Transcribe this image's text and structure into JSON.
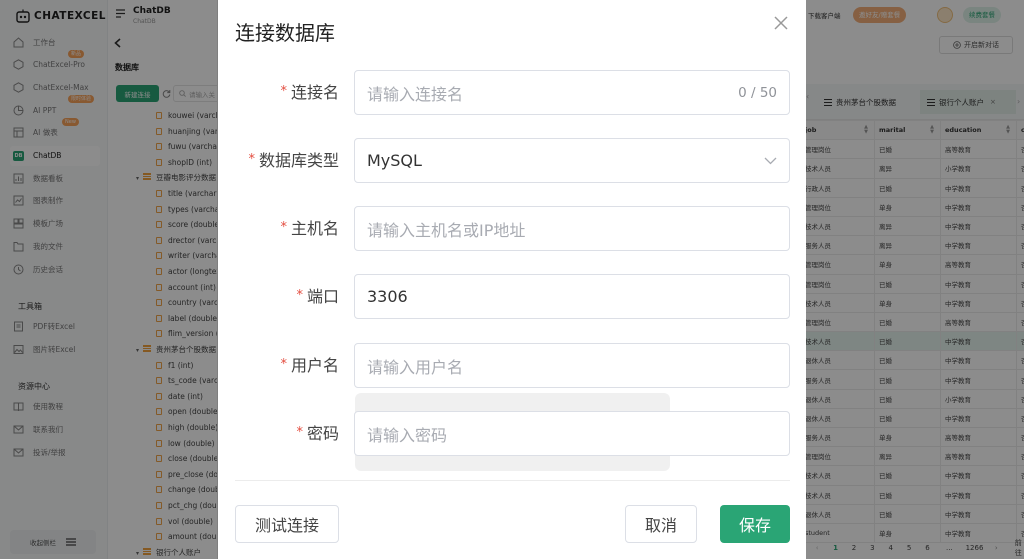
{
  "app": {
    "logo_text": "ChatExcel",
    "colors": {
      "accent": "#2aa575",
      "badge": "#f7a25a",
      "required": "#e34b3e"
    }
  },
  "sidebar": {
    "items": [
      {
        "label": "工作台",
        "icon": "home-icon"
      },
      {
        "label": "ChatExcel-Pro",
        "icon": "hexagon-icon",
        "badge": "新品"
      },
      {
        "label": "ChatExcel-Max",
        "icon": "hexagon-icon"
      },
      {
        "label": "AI PPT",
        "icon": "ppt-icon",
        "badge": "限时体验"
      },
      {
        "label": "AI 做表",
        "icon": "table-icon",
        "badge": "New"
      },
      {
        "label": "ChatDB",
        "icon": "db-icon",
        "active": true
      },
      {
        "label": "数据看板",
        "icon": "dashboard-icon"
      },
      {
        "label": "图表制作",
        "icon": "chart-icon"
      },
      {
        "label": "模板广场",
        "icon": "template-icon"
      },
      {
        "label": "我的文件",
        "icon": "file-icon"
      },
      {
        "label": "历史会话",
        "icon": "history-icon"
      }
    ],
    "tools_title": "工具箱",
    "tools": [
      {
        "label": "PDF转Excel",
        "icon": "pdf-icon"
      },
      {
        "label": "图片转Excel",
        "icon": "image-icon"
      }
    ],
    "resources_title": "资源中心",
    "resources": [
      {
        "label": "使用教程",
        "icon": "book-icon"
      },
      {
        "label": "联系我们",
        "icon": "mail-icon"
      },
      {
        "label": "投诉/举报",
        "icon": "mail-icon"
      }
    ],
    "collapse_label": "收起侧栏"
  },
  "db_panel": {
    "title": "ChatDB",
    "subtitle": "ChatDB",
    "section_label": "数据库",
    "new_conn_label": "新建连接",
    "search_placeholder": "请输入关",
    "tree_top_fields": [
      "kouwei (varchar",
      "huanjing (varc",
      "fuwu (varchar",
      "shopID (int)"
    ],
    "table_douban": "豆瓣电影评分数据",
    "douban_fields": [
      "title (varchar(2",
      "types (varcha",
      "score (double",
      "drector (varch",
      "writer (varcha",
      "actor (longtex",
      "account (int)",
      "country (varch",
      "label (double)",
      "flim_version ("
    ],
    "table_moutai": "贵州茅台个股数据",
    "moutai_fields": [
      "f1 (int)",
      "ts_code (varc",
      "date (int)",
      "open (double)",
      "high (double)",
      "low (double)",
      "close (double",
      "pre_close (do",
      "change (doub",
      "pct_chg (doul",
      "vol (double)",
      "amount (doub"
    ],
    "table_bank": "银行个人账户"
  },
  "right_panel": {
    "download_label": "下载客户端",
    "promo_label": "邀好友/赠套餐",
    "renew_label": "续费套餐",
    "new_chat_label": "开启新对话",
    "tab1_label": "贵州茅台个股数据",
    "tab2_label": "银行个人账户",
    "columns": [
      "job",
      "marital",
      "education",
      "c"
    ],
    "rows": [
      [
        "管理岗位",
        "已婚",
        "高等教育",
        "否"
      ],
      [
        "技术人员",
        "离异",
        "小学教育",
        "否"
      ],
      [
        "行政人员",
        "已婚",
        "中学教育",
        "否"
      ],
      [
        "管理岗位",
        "单身",
        "中学教育",
        "否"
      ],
      [
        "技术人员",
        "离异",
        "中学教育",
        "否"
      ],
      [
        "服务人员",
        "离异",
        "中学教育",
        "否"
      ],
      [
        "管理岗位",
        "单身",
        "高等教育",
        "否"
      ],
      [
        "管理岗位",
        "已婚",
        "中学教育",
        "否"
      ],
      [
        "技术人员",
        "单身",
        "中学教育",
        "否"
      ],
      [
        "管理岗位",
        "已婚",
        "高等教育",
        "否"
      ],
      [
        "技术人员",
        "已婚",
        "中学教育",
        "否"
      ],
      [
        "退休人员",
        "已婚",
        "中学教育",
        "否"
      ],
      [
        "服务人员",
        "已婚",
        "中学教育",
        "否"
      ],
      [
        "退休人员",
        "已婚",
        "小学教育",
        "否"
      ],
      [
        "退休人员",
        "已婚",
        "中学教育",
        "否"
      ],
      [
        "服务人员",
        "单身",
        "高等教育",
        "否"
      ],
      [
        "管理岗位",
        "离异",
        "高等教育",
        "否"
      ],
      [
        "技术人员",
        "已婚",
        "中学教育",
        "否"
      ],
      [
        "技术人员",
        "已婚",
        "中学教育",
        "否"
      ],
      [
        "退休人员",
        "已婚",
        "中学教育",
        "否"
      ],
      [
        "student",
        "单身",
        "中学教育",
        "否"
      ]
    ],
    "highlight_row": 10,
    "pagination": {
      "pages": [
        "1",
        "2",
        "3",
        "4",
        "5",
        "6",
        "...",
        "1266"
      ],
      "current": "1",
      "next_label": "前往"
    }
  },
  "modal": {
    "title": "连接数据库",
    "fields": [
      {
        "label": "连接名",
        "placeholder": "请输入连接名",
        "value": "",
        "counter": "0 / 50"
      },
      {
        "label": "数据库类型",
        "placeholder": "",
        "value": "MySQL",
        "dropdown": true
      },
      {
        "label": "主机名",
        "placeholder": "请输入主机名或IP地址",
        "value": ""
      },
      {
        "label": "端口",
        "placeholder": "",
        "value": "3306"
      },
      {
        "label": "用户名",
        "placeholder": "请输入用户名",
        "value": ""
      },
      {
        "label": "密码",
        "placeholder": "请输入密码",
        "value": ""
      }
    ],
    "required_mark": "*",
    "test_label": "测试连接",
    "cancel_label": "取消",
    "save_label": "保存"
  }
}
